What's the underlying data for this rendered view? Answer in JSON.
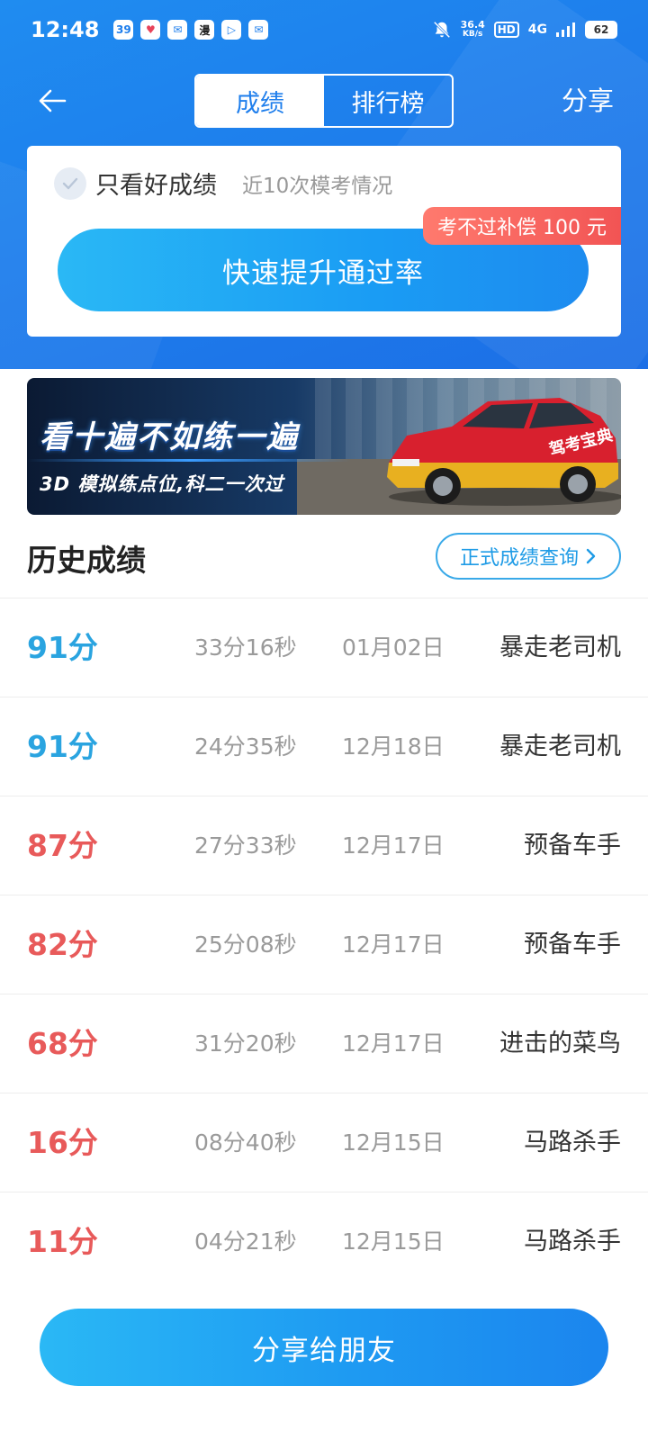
{
  "status_bar": {
    "time": "12:48",
    "apps": [
      "39",
      "♥",
      "✉",
      "漫",
      "▷",
      "✉"
    ],
    "net_speed_value": "36.4",
    "net_speed_unit": "KB/s",
    "hd": "HD",
    "signal": "4G",
    "battery": "62"
  },
  "nav": {
    "tabs": [
      {
        "label": "成绩",
        "active": true
      },
      {
        "label": "排行榜",
        "active": false
      }
    ],
    "share_label": "分享"
  },
  "card": {
    "filter_label": "只看好成绩",
    "filter_sub": "近10次模考情况",
    "boost_label": "快速提升通过率",
    "promo_tag": "考不过补偿 100 元"
  },
  "banner": {
    "title": "看十遍不如练一遍",
    "subtitle": "3D 模拟练点位,科二一次过",
    "car_text": "驾考宝典"
  },
  "history": {
    "title": "历史成绩",
    "official_label": "正式成绩查询",
    "rows": [
      {
        "score": "91分",
        "time": "33分16秒",
        "date": "01月02日",
        "title": "暴走老司机",
        "pass": true
      },
      {
        "score": "91分",
        "time": "24分35秒",
        "date": "12月18日",
        "title": "暴走老司机",
        "pass": true
      },
      {
        "score": "87分",
        "time": "27分33秒",
        "date": "12月17日",
        "title": "预备车手",
        "pass": false
      },
      {
        "score": "82分",
        "time": "25分08秒",
        "date": "12月17日",
        "title": "预备车手",
        "pass": false
      },
      {
        "score": "68分",
        "time": "31分20秒",
        "date": "12月17日",
        "title": "进击的菜鸟",
        "pass": false
      },
      {
        "score": "16分",
        "time": "08分40秒",
        "date": "12月15日",
        "title": "马路杀手",
        "pass": false
      },
      {
        "score": "11分",
        "time": "04分21秒",
        "date": "12月15日",
        "title": "马路杀手",
        "pass": false
      }
    ]
  },
  "bottom": {
    "share_friends_label": "分享给朋友"
  },
  "colors": {
    "primary_blue": "#1e7eec",
    "good_score": "#2aa4e0",
    "bad_score": "#e85a5a",
    "promo_red": "#f25454"
  }
}
